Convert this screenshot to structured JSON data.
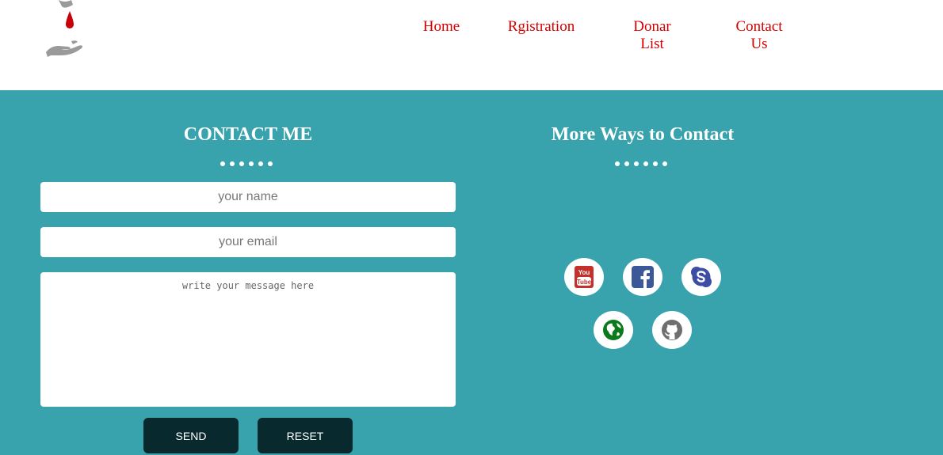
{
  "nav": {
    "items": [
      {
        "label": "Home"
      },
      {
        "label": "Rgistration"
      },
      {
        "label": "Donar List"
      },
      {
        "label": "Contact Us"
      }
    ]
  },
  "contact_form": {
    "title": "CONTACT ME",
    "name_placeholder": "your name",
    "email_placeholder": "your email",
    "message_placeholder": "write your message here",
    "send_label": "SEND",
    "reset_label": "RESET"
  },
  "more_ways": {
    "title": "More Ways to Contact",
    "icons": [
      "youtube-icon",
      "facebook-icon",
      "skype-icon",
      "globe-icon",
      "github-icon"
    ]
  },
  "colors": {
    "nav_link": "#d40000",
    "section_bg": "#38a3ad",
    "button_bg": "#082a2e"
  }
}
